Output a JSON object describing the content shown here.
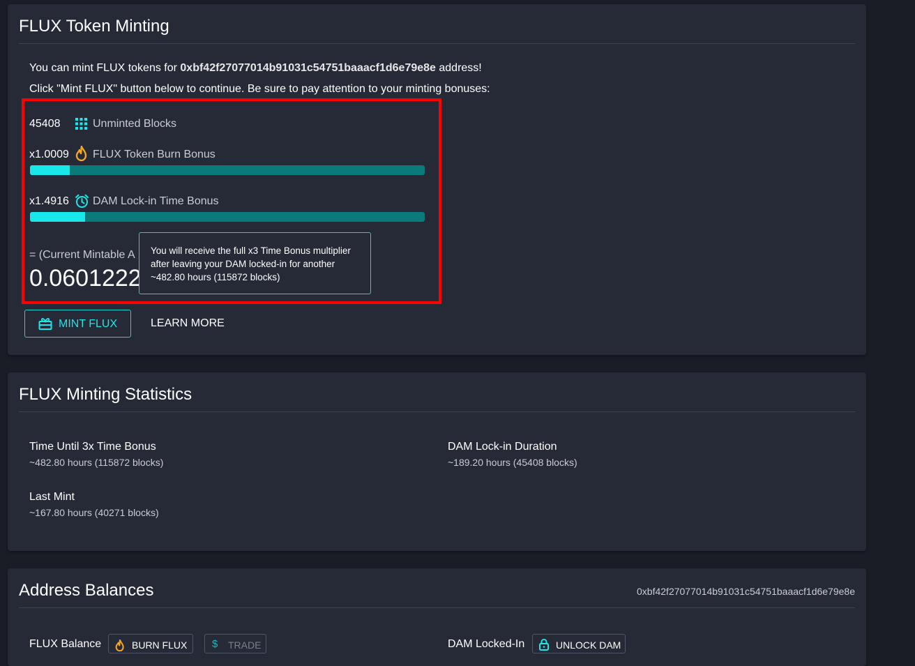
{
  "mint_card": {
    "title": "FLUX Token Minting",
    "line1_prefix": "You can mint FLUX tokens for ",
    "address": "0xbf42f27077014b91031c54751baaacf1d6e79e8e",
    "line1_suffix": " address!",
    "line2": "Click \"Mint FLUX\" button below to continue. Be sure to pay attention to your minting bonuses:",
    "unminted_value": "45408",
    "unminted_label": "Unminted Blocks",
    "burn_value": "x1.0009",
    "burn_label": "FLUX Token Burn Bonus",
    "burn_progress": 0.1,
    "lockin_value": "x1.4916",
    "lockin_label": "DAM Lock-in Time Bonus",
    "lockin_progress": 0.14,
    "total_label": "= (Current Mintable A",
    "total_amount": "0.0601222",
    "tooltip": "You will receive the full x3 Time Bonus multiplier after leaving your DAM locked-in for another ~482.80 hours (115872 blocks)",
    "mint_button": "MINT FLUX",
    "learn_more": "LEARN MORE",
    "icons": {
      "blocks": "grid-icon",
      "burn": "fire-icon",
      "lockin": "alarm-clock-icon",
      "mint": "gift-icon"
    }
  },
  "stats_card": {
    "title": "FLUX Minting Statistics",
    "items": [
      {
        "label": "Time Until 3x Time Bonus",
        "value": "~482.80 hours (115872 blocks)"
      },
      {
        "label": "DAM Lock-in Duration",
        "value": "~189.20 hours (45408 blocks)"
      },
      {
        "label": "Last Mint",
        "value": "~167.80 hours (40271 blocks)"
      }
    ]
  },
  "balances_card": {
    "title": "Address Balances",
    "address": "0xbf42f27077014b91031c54751baaacf1d6e79e8e",
    "flux_balance_label": "FLUX Balance",
    "burn_button": "BURN FLUX",
    "trade_button": "TRADE",
    "dam_locked_label": "DAM Locked-In",
    "unlock_button": "UNLOCK DAM"
  },
  "colors": {
    "accent": "#18e8ea",
    "bar_track": "#0b7a7a",
    "highlight": "#ff0000",
    "fire": "#f5a623"
  }
}
